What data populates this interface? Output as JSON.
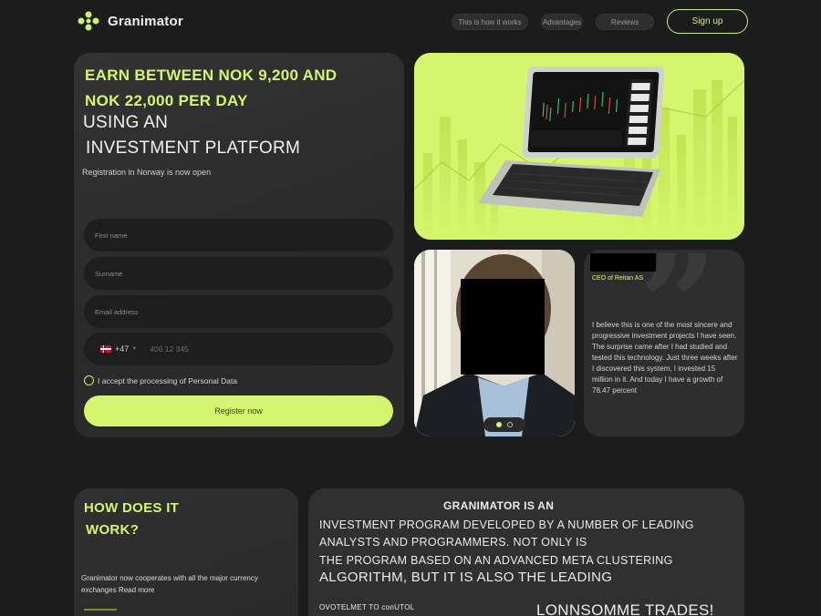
{
  "header": {
    "brand": "Granimator",
    "nav": [
      "This is how it works",
      "Advantages",
      "Reviews"
    ],
    "signup": "Sign up"
  },
  "hero": {
    "headline_line1": "EARN BETWEEN NOK 9,200 AND",
    "headline_line2": "NOK 22,000 PER DAY",
    "headline_line3": "USING AN",
    "headline_line4": "INVESTMENT PLATFORM",
    "subtitle": "Registration in Norway is now open",
    "form": {
      "first_name_placeholder": "First name",
      "surname_placeholder": "Surname",
      "email_placeholder": "Email address",
      "dial_code": "+47",
      "phone_placeholder": "406 12 345",
      "consent": "I accept the processing of Personal Data",
      "submit": "Register now"
    }
  },
  "testimonial": {
    "role": "CEO of Reitan AS",
    "quote": "I believe this is one of the most sincere and progressive investment projects I have seen. The surprise came after I had studied and tested this technology. Just three weeks after I discovered this system, I invested 15 million in it. And today I have a growth of 78.47 percent"
  },
  "how": {
    "title_line1": "HOW DOES IT",
    "title_line2": "WORK?",
    "text": "Granimator now cooperates with all the major currency exchanges Read more"
  },
  "about": {
    "line1": "GRANIMATOR IS AN",
    "line2": "INVESTMENT PROGRAM DEVELOPED BY A NUMBER OF LEADING",
    "line3": "ANALYSTS AND PROGRAMMERS. NOT ONLY IS",
    "line4": "THE PROGRAM BASED ON AN ADVANCED META CLUSTERING",
    "line5": "ALGORITHM, BUT IT IS ALSO THE LEADING",
    "line6": "OVOTELMET TO conUTOL",
    "line7": "LONNSOMME TRADES!"
  },
  "colors": {
    "accent": "#d4f56f",
    "background": "#1c1c1c",
    "card": "#2c2c2c"
  }
}
